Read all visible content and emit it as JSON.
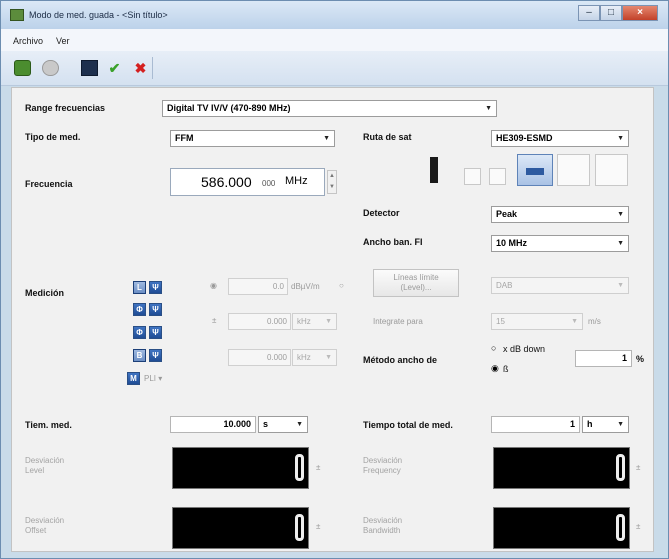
{
  "window": {
    "title": "Modo de med. guada - <Sin título>",
    "controls": {
      "minimize": "–",
      "maximize": "□",
      "close": "×"
    }
  },
  "menu": {
    "items": [
      "Archivo",
      "Ver"
    ]
  },
  "toolbar": {
    "icons": [
      "run-icon",
      "stop-icon",
      "save-icon",
      "check-icon",
      "cancel-icon"
    ],
    "check_glyph": "✔",
    "cancel_glyph": "✖"
  },
  "form": {
    "range": {
      "label": "Range frecuencias",
      "value": "Digital TV IV/V (470-890 MHz)"
    },
    "tipo": {
      "label": "Tipo de med.",
      "value": "FFM"
    },
    "ruta": {
      "label": "Ruta de sat",
      "value": "HE309-ESMD"
    },
    "frecuencia": {
      "label": "Frecuencia",
      "value": "586.000",
      "suffix": "000",
      "unit": "MHz"
    },
    "detector": {
      "label": "Detector",
      "value": "Peak"
    },
    "ancho_fi": {
      "label": "Ancho ban. FI",
      "value": "10 MHz"
    },
    "medicion": {
      "label": "Medición",
      "level": {
        "value": "0.0",
        "unit": "dBµV/m"
      },
      "freq_offset": {
        "sign": "±",
        "value": "0.000",
        "unit": "kHz"
      },
      "bandwidth": {
        "value": "0.000",
        "unit": "kHz"
      },
      "more": "PLI ▾",
      "icon_labels": [
        "L",
        "Ψ",
        "Φ",
        "Ψ",
        "Φ",
        "Ψ",
        "B",
        "Ψ",
        "M"
      ]
    },
    "limit_button": {
      "label_line1": "Líneas límite",
      "label_line2": "(Level)..."
    },
    "dab": {
      "value": "DAB"
    },
    "integrate": {
      "label": "Integrate para",
      "value": "15",
      "unit": "m/s"
    },
    "metodo": {
      "label": "Método ancho de",
      "option1": "x dB down",
      "option2": "ß",
      "value": "1",
      "unit": "%"
    },
    "tiem": {
      "label": "Tiem. med.",
      "value": "10.000",
      "unit": "s"
    },
    "tiempo_total": {
      "label": "Tiempo total de med.",
      "value": "1",
      "unit": "h"
    },
    "displays": [
      {
        "caption_line1": "Desviación",
        "caption_line2": "Level",
        "digit": "0",
        "unit": "±"
      },
      {
        "caption_line1": "Desviación",
        "caption_line2": "Frequency",
        "digit": "0",
        "unit": "±"
      },
      {
        "caption_line1": "Desviación",
        "caption_line2": "Offset",
        "digit": "0",
        "unit": "±"
      },
      {
        "caption_line1": "Desviación",
        "caption_line2": "Bandwidth",
        "digit": "0",
        "unit": "±"
      }
    ]
  },
  "colors": {
    "accent_blue": "#2a5ca8",
    "check_green": "#3aa12a",
    "cancel_red": "#d42020"
  }
}
